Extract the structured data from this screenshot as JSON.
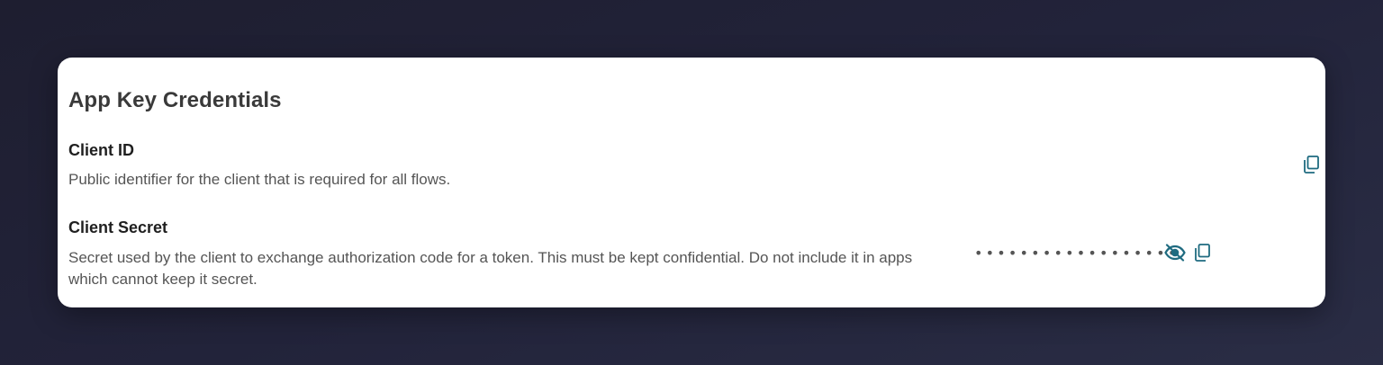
{
  "card": {
    "title": "App Key Credentials"
  },
  "client_id": {
    "title": "Client ID",
    "description": "Public identifier for the client that is required for all flows.",
    "copy_icon": "copy-icon"
  },
  "client_secret": {
    "title": "Client Secret",
    "description": "Secret used by the client to exchange authorization code for a token. This must be kept confidential. Do not include it in apps which cannot keep it secret.",
    "masked_value": "••••••••••••••••••",
    "visibility_icon": "eye-off-icon",
    "copy_icon": "copy-icon"
  },
  "colors": {
    "icon_accent": "#1f6b80",
    "background": "#22233a",
    "card": "#ffffff"
  }
}
